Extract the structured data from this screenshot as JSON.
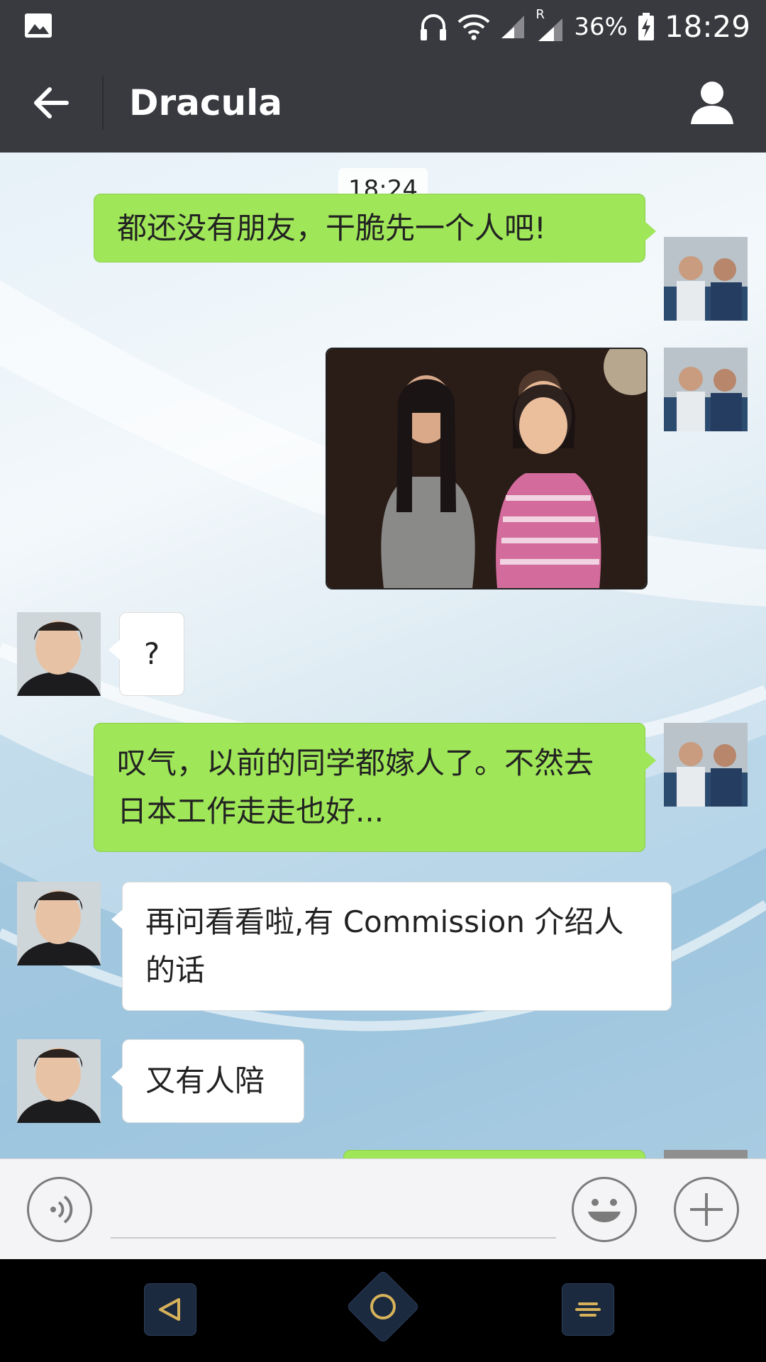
{
  "status_bar": {
    "battery": "36%",
    "time": "18:29",
    "signal_indicator": "R",
    "icons": [
      "gallery-icon",
      "headphones-icon",
      "wifi-icon",
      "signal-icon",
      "roaming-signal-icon",
      "battery-charging-icon"
    ]
  },
  "header": {
    "title": "Dracula",
    "back_icon": "back-arrow-icon",
    "profile_icon": "user-icon"
  },
  "chat": {
    "timestamp": "18:24",
    "messages": [
      {
        "from": "me",
        "type": "text",
        "text": "都还没有朋友，干脆先一个人吧!"
      },
      {
        "from": "me",
        "type": "image"
      },
      {
        "from": "them",
        "type": "text",
        "text": "?"
      },
      {
        "from": "me",
        "type": "text",
        "text": "叹气，以前的同学都嫁人了。不然去日本工作走走也好..."
      },
      {
        "from": "them",
        "type": "text",
        "text": "再问看看啦,有 Commission 介绍人的话"
      },
      {
        "from": "them",
        "type": "text",
        "text": "又有人陪"
      },
      {
        "from": "me",
        "type": "text",
        "text": ""
      }
    ]
  },
  "input_bar": {
    "voice_icon": "voice-icon",
    "emoji_icon": "emoji-icon",
    "plus_icon": "plus-icon",
    "value": ""
  },
  "nav_bar": {
    "icons": [
      "nav-back-icon",
      "nav-home-icon",
      "nav-menu-icon"
    ]
  },
  "colors": {
    "header_bg": "#393a3f",
    "my_bubble": "#9fe658",
    "their_bubble": "#ffffff",
    "nav_accent": "#d8b25a"
  }
}
